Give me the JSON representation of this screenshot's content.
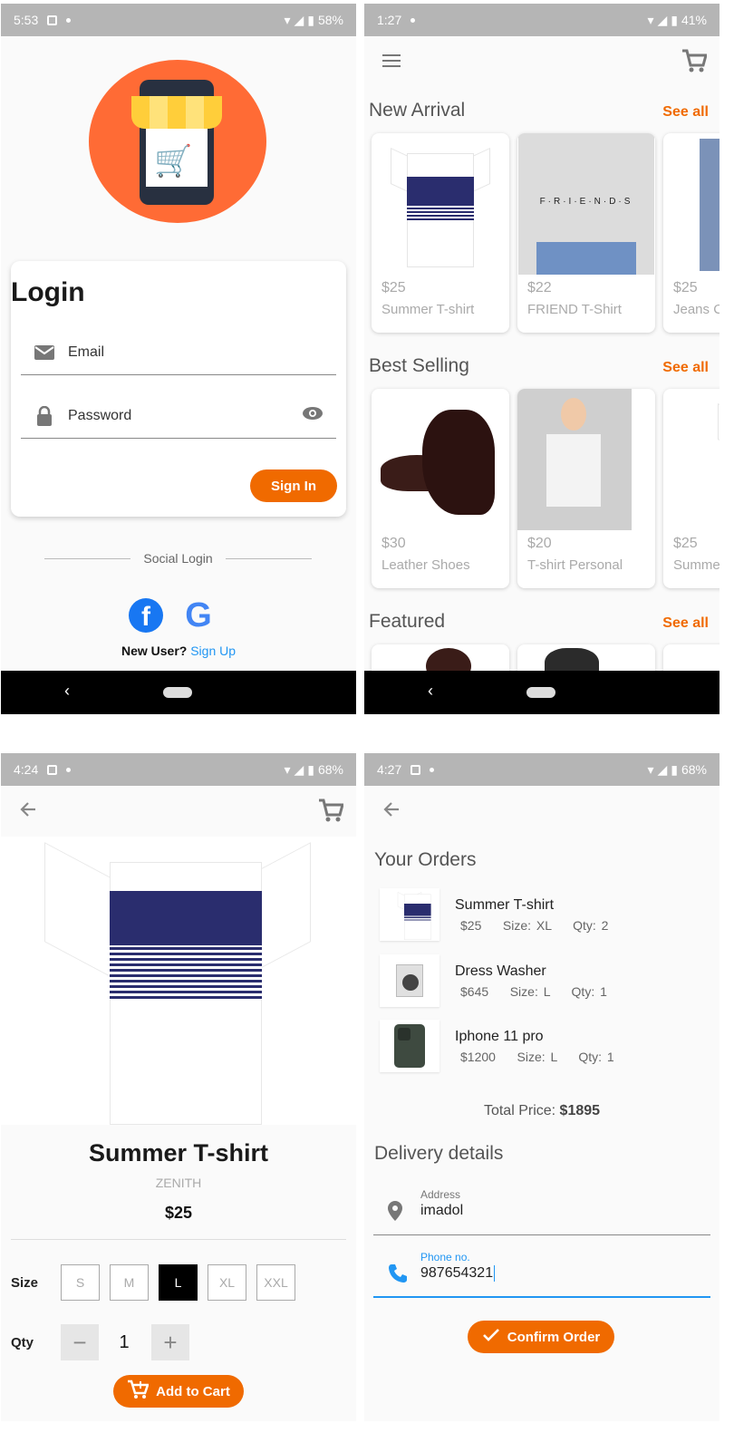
{
  "screen1": {
    "status": {
      "time": "5:53",
      "battery": "58%"
    },
    "login_title": "Login",
    "email_placeholder": "Email",
    "password_placeholder": "Password",
    "signin_label": "Sign In",
    "social_label": "Social Login",
    "facebook_glyph": "f",
    "google_glyph": "G",
    "new_user_label": "New User?",
    "signup_label": "Sign Up"
  },
  "screen2": {
    "status": {
      "time": "1:27",
      "battery": "41%"
    },
    "sections": [
      {
        "title": "New Arrival",
        "see_all": "See all",
        "items": [
          {
            "price": "$25",
            "name": "Summer T-shirt"
          },
          {
            "price": "$22",
            "name": "FRIEND T-Shirt"
          },
          {
            "price": "$25",
            "name": "Jeans C"
          }
        ]
      },
      {
        "title": "Best Selling",
        "see_all": "See all",
        "items": [
          {
            "price": "$30",
            "name": "Leather Shoes"
          },
          {
            "price": "$20",
            "name": "T-shirt Personal"
          },
          {
            "price": "$25",
            "name": "Summe"
          }
        ]
      },
      {
        "title": "Featured",
        "see_all": "See all"
      }
    ],
    "friends_print": "F·R·I·E·N·D·S"
  },
  "screen3": {
    "status": {
      "time": "4:24",
      "battery": "68%"
    },
    "product_name": "Summer T-shirt",
    "brand": "ZENITH",
    "price": "$25",
    "size_label": "Size",
    "sizes": [
      "S",
      "M",
      "L",
      "XL",
      "XXL"
    ],
    "selected_size": "L",
    "qty_label": "Qty",
    "qty_value": "1",
    "qty_minus": "−",
    "qty_plus": "+",
    "add_to_cart_label": "Add to Cart"
  },
  "screen4": {
    "status": {
      "time": "4:27",
      "battery": "68%"
    },
    "orders_title": "Your Orders",
    "orders": [
      {
        "name": "Summer T-shirt",
        "meta": "$25    Size: XL    Qty: 2"
      },
      {
        "name": "Dress Washer",
        "meta": "$645    Size: L    Qty: 1"
      },
      {
        "name": "Iphone 11 pro",
        "meta": "$1200    Size: L    Qty: 1"
      }
    ],
    "total_label": "Total Price: ",
    "total_value": "$1895",
    "delivery_title": "Delivery details",
    "address_label": "Address",
    "address_value": "imadol",
    "phone_label": "Phone no.",
    "phone_value": "987654321",
    "confirm_label": "Confirm Order"
  },
  "colors": {
    "accent": "#f06a00",
    "link": "#2196f3",
    "status_bar": "#b5b5b5"
  }
}
